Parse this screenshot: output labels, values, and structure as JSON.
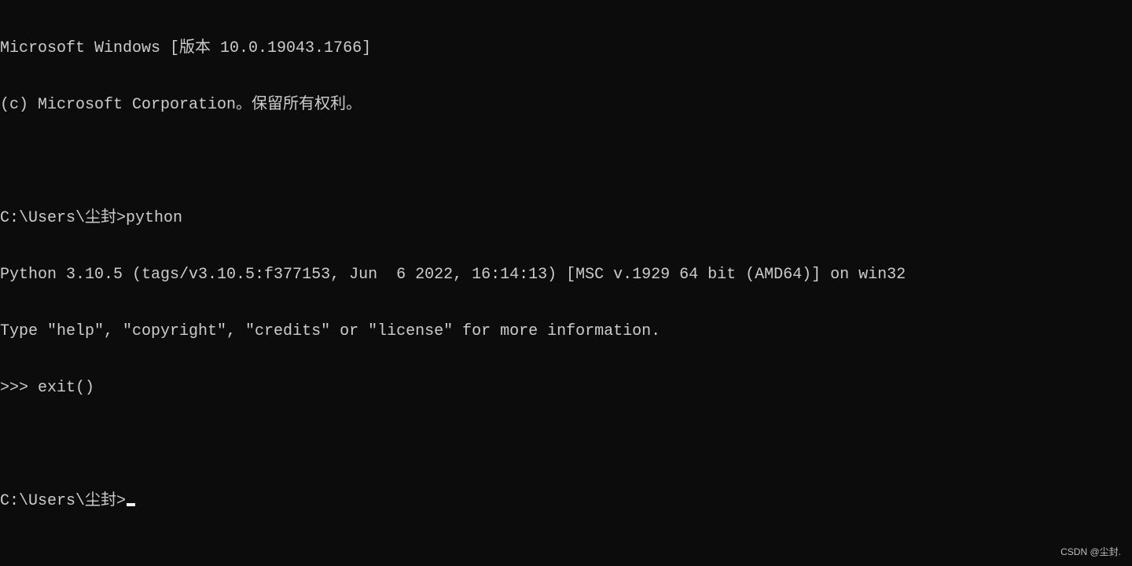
{
  "console": {
    "lines": [
      "Microsoft Windows [版本 10.0.19043.1766]",
      "(c) Microsoft Corporation。保留所有权利。",
      "",
      "C:\\Users\\尘封>python",
      "Python 3.10.5 (tags/v3.10.5:f377153, Jun  6 2022, 16:14:13) [MSC v.1929 64 bit (AMD64)] on win32",
      "Type \"help\", \"copyright\", \"credits\" or \"license\" for more information.",
      ">>> exit()",
      "",
      "C:\\Users\\尘封>"
    ]
  },
  "watermark": "CSDN @尘封.",
  "colors": {
    "background": "#0c0c0c",
    "text": "#cccccc"
  }
}
